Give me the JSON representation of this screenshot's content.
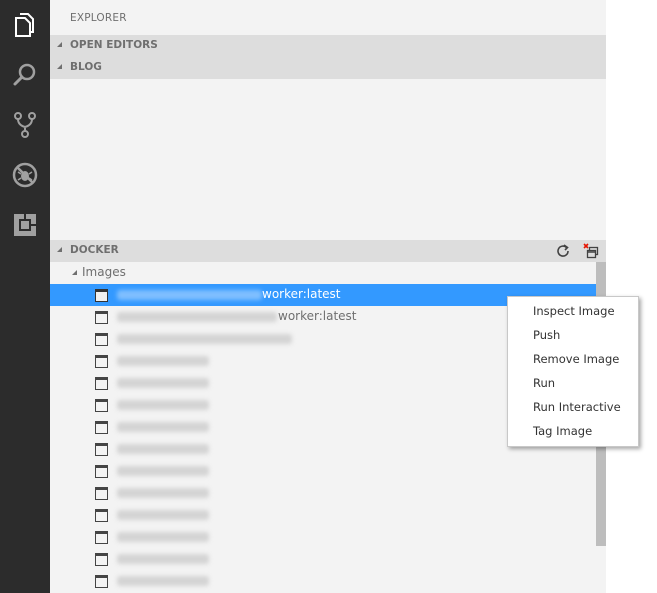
{
  "activity_bar": {
    "items": [
      {
        "name": "explorer",
        "icon": "files-icon",
        "active": true
      },
      {
        "name": "search",
        "icon": "search-icon",
        "active": false
      },
      {
        "name": "source-control",
        "icon": "git-branch-icon",
        "active": false
      },
      {
        "name": "debug",
        "icon": "debug-icon",
        "active": false
      },
      {
        "name": "extensions",
        "icon": "extensions-icon",
        "active": false
      }
    ]
  },
  "sidebar": {
    "title": "EXPLORER",
    "sections": {
      "open_editors": {
        "label": "OPEN EDITORS",
        "expanded": true
      },
      "blog": {
        "label": "BLOG",
        "expanded": true
      },
      "docker": {
        "label": "DOCKER",
        "actions": [
          {
            "name": "refresh",
            "icon": "refresh-icon"
          },
          {
            "name": "remove-all",
            "icon": "collapse-remove-icon"
          }
        ],
        "images_node": {
          "label": "Images",
          "expanded": true
        },
        "images": [
          {
            "name_suffix": "worker:latest",
            "selected": true,
            "blurred_prefix": true
          },
          {
            "name_suffix": "worker:latest",
            "selected": false,
            "blurred_prefix": true
          },
          {
            "name_suffix": "",
            "selected": false,
            "blurred_prefix": true
          },
          {
            "name_suffix": "",
            "selected": false,
            "blurred_prefix": true
          },
          {
            "name_suffix": "",
            "selected": false,
            "blurred_prefix": true
          },
          {
            "name_suffix": "",
            "selected": false,
            "blurred_prefix": true
          },
          {
            "name_suffix": "",
            "selected": false,
            "blurred_prefix": true
          },
          {
            "name_suffix": "",
            "selected": false,
            "blurred_prefix": true
          },
          {
            "name_suffix": "",
            "selected": false,
            "blurred_prefix": true
          },
          {
            "name_suffix": "",
            "selected": false,
            "blurred_prefix": true
          },
          {
            "name_suffix": "",
            "selected": false,
            "blurred_prefix": true
          },
          {
            "name_suffix": "",
            "selected": false,
            "blurred_prefix": true
          },
          {
            "name_suffix": "",
            "selected": false,
            "blurred_prefix": true
          },
          {
            "name_suffix": "",
            "selected": false,
            "blurred_prefix": true
          }
        ]
      }
    }
  },
  "context_menu": {
    "items": [
      "Inspect Image",
      "Push",
      "Remove Image",
      "Run",
      "Run Interactive",
      "Tag Image"
    ]
  },
  "colors": {
    "activity_bar_bg": "#2c2c2c",
    "sidebar_bg": "#f3f3f3",
    "section_header_bg": "#dddddd",
    "selection": "#3399ff"
  }
}
